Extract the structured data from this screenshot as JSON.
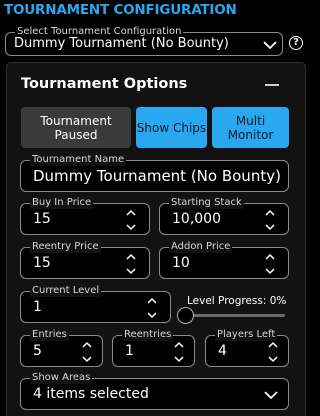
{
  "header": {
    "title": "TOURNAMENT CONFIGURATION"
  },
  "tournament_select": {
    "label": "Select Tournament Configuration",
    "value": "Dummy Tournament (No Bounty)"
  },
  "help": {
    "glyph": "?"
  },
  "panel": {
    "title": "Tournament Options",
    "buttons": {
      "paused": "Tournament Paused",
      "show_chips": "Show Chips",
      "multi_monitor": "Multi Monitor"
    }
  },
  "fields": {
    "tournament_name": {
      "label": "Tournament Name",
      "value": "Dummy Tournament (No Bounty)"
    },
    "buy_in": {
      "label": "Buy In Price",
      "value": "15"
    },
    "starting_stack": {
      "label": "Starting Stack",
      "value": "10,000"
    },
    "reentry_price": {
      "label": "Reentry Price",
      "value": "15"
    },
    "addon_price": {
      "label": "Addon Price",
      "value": "10"
    },
    "current_level": {
      "label": "Current Level",
      "value": "1"
    },
    "entries": {
      "label": "Entries",
      "value": "5"
    },
    "reentries": {
      "label": "Reentries",
      "value": "1"
    },
    "players_left": {
      "label": "Players Left",
      "value": "4"
    },
    "show_areas": {
      "label": "Show Areas",
      "value": "4 items selected"
    }
  },
  "level_progress": {
    "label": "Level Progress: 0%",
    "value": 0
  },
  "colors": {
    "accent": "#29a8f0",
    "panel_bg": "#121212",
    "button_inactive": "#3a3a3a"
  }
}
